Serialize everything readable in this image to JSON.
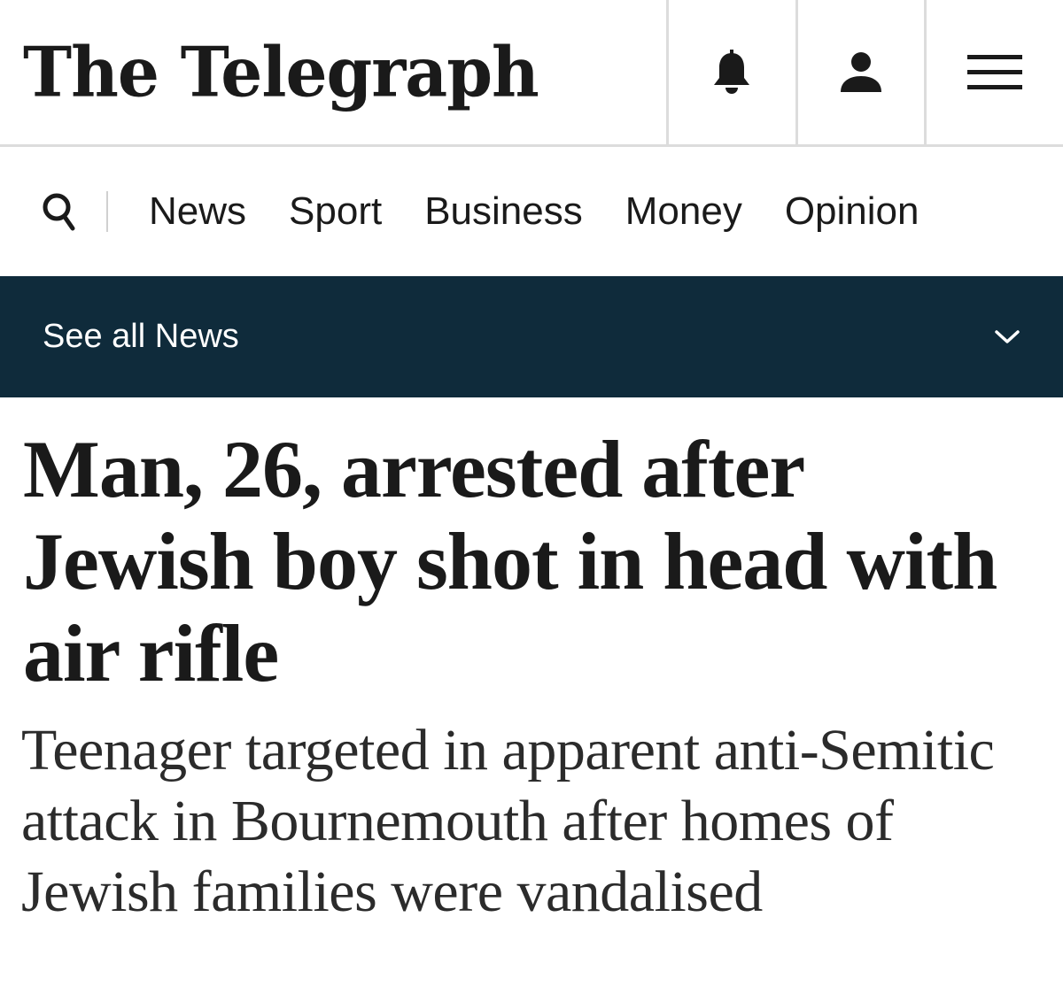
{
  "masthead": {
    "logo_text": "The Telegraph",
    "icons": [
      "bell-icon",
      "user-icon",
      "menu-icon"
    ]
  },
  "nav": {
    "search_icon": "search-icon",
    "items": [
      "News",
      "Sport",
      "Business",
      "Money",
      "Opinion"
    ]
  },
  "section_bar": {
    "label": "See all News",
    "icon": "chevron-down-icon",
    "background": "#0f2b3b"
  },
  "article": {
    "headline": "Man, 26, arrested after Jewish boy shot in head with air rifle",
    "standfirst": "Teenager targeted in apparent anti-Semitic attack in Bournemouth after homes of Jewish families were vandalised"
  }
}
